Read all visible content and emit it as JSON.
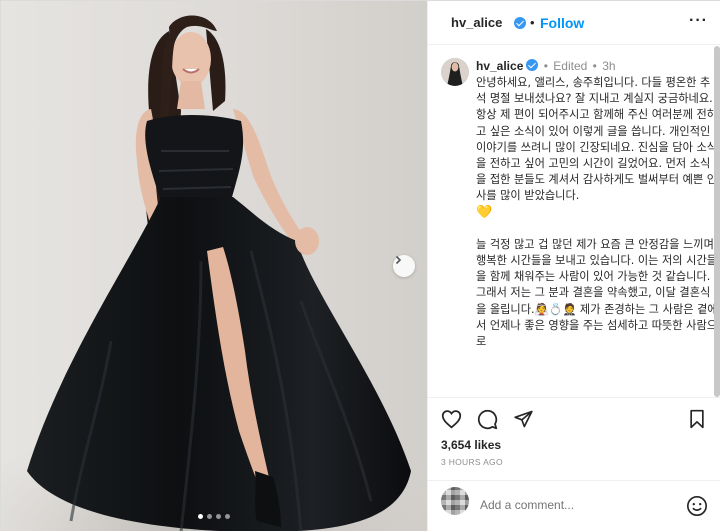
{
  "post": {
    "username": "hv_alice",
    "follow_label": "Follow",
    "header_separator": "•",
    "more_label": "···"
  },
  "caption": {
    "username": "hv_alice",
    "edited_label": "Edited",
    "dot": "•",
    "time": "3h",
    "paragraph1": "안녕하세요, 앨리스, 송주희입니다. 다들 평온한 추석 명절 보내셨나요? 잘 지내고 계실지 궁금하네요. 항상 제 편이 되어주시고 함께해 주신 여러분께 전하고 싶은 소식이 있어 이렇게 글을 씁니다. 개인적인 이야기를 쓰려니 많이 긴장되네요. 진심을 담아 소식을 전하고 싶어 고민의 시간이 길었어요. 먼저 소식을 접한 분들도 계셔서 감사하게도 벌써부터 예쁜 인사를 많이 받았습니다.",
    "heart_emoji": "💛",
    "paragraph2": "늘 걱정 많고 겁 많던 제가 요즘 큰 안정감을 느끼며 행복한 시간들을 보내고 있습니다. 이는 저의 시간들을 함께 채워주는 사람이 있어 가능한 것 같습니다. 그래서 저는 그 분과 결혼을 약속했고, 이달 결혼식을 올립니다.",
    "inline_emojis": "👰💍🤵",
    "paragraph3": " 제가 존경하는 그 사람은 곁에서 언제나 좋은 영향을 주는 섬세하고 따뜻한 사람으로"
  },
  "stats": {
    "likes": "3,654 likes",
    "time_ago": "3 HOURS AGO"
  },
  "comment": {
    "placeholder": "Add a comment..."
  },
  "carousel": {
    "total": 4,
    "active": 1
  },
  "colors": {
    "accent": "#0095f6",
    "verified": "#3897f0",
    "dress": "#111315",
    "background": "#dcd9d6"
  },
  "icons": {
    "verified": "verified-badge-icon",
    "more": "more-options-icon",
    "next": "chevron-right-icon",
    "like": "heart-icon",
    "comment": "comment-bubble-icon",
    "share": "paper-plane-icon",
    "save": "bookmark-icon",
    "emoji": "emoji-smile-icon"
  }
}
